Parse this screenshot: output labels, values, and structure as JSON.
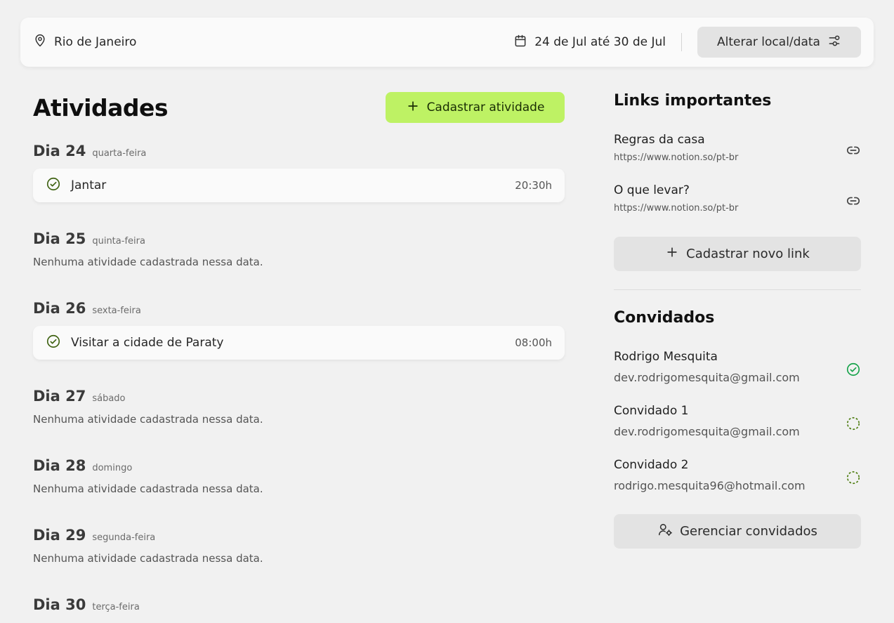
{
  "header": {
    "location": "Rio de Janeiro",
    "dates": "24 de Jul até 30 de Jul",
    "change_button": "Alterar local/data"
  },
  "activities": {
    "title": "Atividades",
    "add_button": "Cadastrar atividade",
    "days": [
      {
        "day": "Dia 24",
        "weekday": "quarta-feira",
        "items": [
          {
            "name": "Jantar",
            "time": "20:30h"
          }
        ]
      },
      {
        "day": "Dia 25",
        "weekday": "quinta-feira",
        "empty": "Nenhuma atividade cadastrada nessa data."
      },
      {
        "day": "Dia 26",
        "weekday": "sexta-feira",
        "items": [
          {
            "name": "Visitar a cidade de Paraty",
            "time": "08:00h"
          }
        ]
      },
      {
        "day": "Dia 27",
        "weekday": "sábado",
        "empty": "Nenhuma atividade cadastrada nessa data."
      },
      {
        "day": "Dia 28",
        "weekday": "domingo",
        "empty": "Nenhuma atividade cadastrada nessa data."
      },
      {
        "day": "Dia 29",
        "weekday": "segunda-feira",
        "empty": "Nenhuma atividade cadastrada nessa data."
      },
      {
        "day": "Dia 30",
        "weekday": "terça-feira"
      }
    ]
  },
  "links": {
    "title": "Links importantes",
    "items": [
      {
        "title": "Regras da casa",
        "url": "https://www.notion.so/pt-br"
      },
      {
        "title": "O que levar?",
        "url": "https://www.notion.so/pt-br"
      }
    ],
    "add_button": "Cadastrar novo link"
  },
  "guests": {
    "title": "Convidados",
    "items": [
      {
        "name": "Rodrigo Mesquita",
        "email": "dev.rodrigomesquita@gmail.com",
        "status": "confirmed"
      },
      {
        "name": "Convidado 1",
        "email": "dev.rodrigomesquita@gmail.com",
        "status": "pending"
      },
      {
        "name": "Convidado 2",
        "email": "rodrigo.mesquita96@hotmail.com",
        "status": "pending"
      }
    ],
    "manage_button": "Gerenciar convidados"
  },
  "colors": {
    "accent": "#bef264",
    "check_green": "#3f6212",
    "confirmed": "#16a34a",
    "background": "#f1f1f1"
  },
  "icons": {
    "location": "map-pin-icon",
    "calendar": "calendar-icon",
    "settings": "sliders-icon",
    "plus": "plus-icon",
    "done": "circle-check-icon",
    "link": "link-icon",
    "pending": "circle-dashed-icon",
    "user_gear": "user-cog-icon"
  }
}
